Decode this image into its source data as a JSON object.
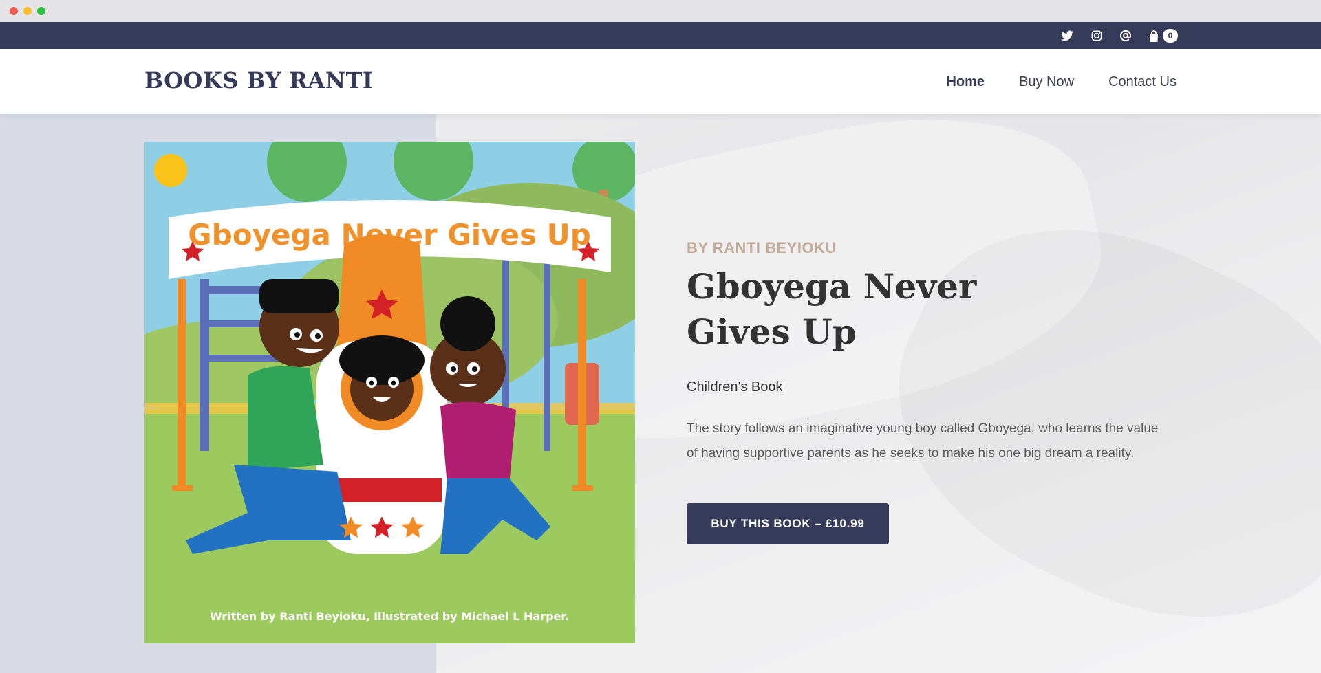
{
  "topbar": {
    "icons": [
      "twitter-icon",
      "instagram-icon",
      "at-icon",
      "shopping-bag-icon"
    ],
    "cart_count": "0"
  },
  "header": {
    "logo": "BOOKS BY RANTI",
    "nav": [
      {
        "label": "Home",
        "active": true
      },
      {
        "label": "Buy Now",
        "active": false
      },
      {
        "label": "Contact Us",
        "active": false
      }
    ]
  },
  "book": {
    "byline": "BY RANTI BEYIOKU",
    "title": "Gboyega Never Gives Up",
    "category": "Children's Book",
    "description": "The story follows an imaginative young boy called Gboyega, who learns the value of having supportive parents as he seeks to make his one big dream a reality.",
    "buy_button": "BUY THIS BOOK – £10.99"
  },
  "cover": {
    "banner_text": "Gboyega Never Gives Up",
    "credit_text": "Written by Ranti Beyioku, Illustrated by Michael L Harper."
  },
  "colors": {
    "primary": "#363b59",
    "byline": "#c2aa9a",
    "banner_text": "#f0922b"
  }
}
